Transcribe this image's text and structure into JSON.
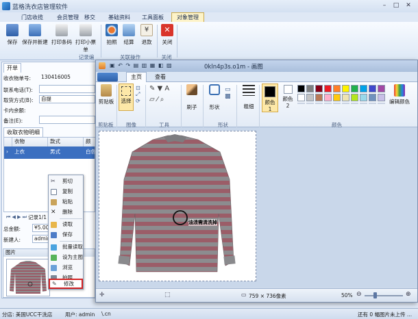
{
  "app": {
    "title": "蓝格洗衣店管理软件",
    "window_controls": [
      "–",
      "□",
      "✕"
    ]
  },
  "menu_tabs": [
    "门店收揽",
    "会员管理",
    "移交",
    "基础资料",
    "工具面板",
    "对象管理"
  ],
  "ribbon": {
    "groups": [
      {
        "label": "记录编",
        "buttons": [
          "保存",
          "保存并新建",
          "打印条码",
          "打印小票 单"
        ]
      },
      {
        "label": "关联操作",
        "buttons": [
          "拍照",
          "结算",
          "退款"
        ]
      },
      {
        "label": "关闭",
        "buttons": [
          "关闭"
        ]
      }
    ]
  },
  "left_panel": {
    "tab": "开单",
    "fields": [
      {
        "label": "收衣物单号:",
        "value": "130416005"
      },
      {
        "label": "联系电话(T):",
        "value": ""
      },
      {
        "label": "取货方式(B):",
        "value": "自提"
      },
      {
        "label": "卡内余额:",
        "value": ""
      },
      {
        "label": "备注(E):",
        "value": ""
      }
    ],
    "detail_tab": "收取衣物明细",
    "grid_headers": [
      "衣物",
      "款式",
      "颜色"
    ],
    "grid_row": [
      "上衣",
      "男式",
      "白色"
    ],
    "pager": "记录1/1",
    "total_label": "总金额:",
    "total_value": "¥5.00",
    "creator_label": "新建人:",
    "creator_value": "admin",
    "image_label": "图片"
  },
  "context_menu": {
    "items": [
      "剪切",
      "复制",
      "粘贴",
      "删除",
      "读取",
      "保存",
      "批量读取",
      "设为主图",
      "浏览",
      "拍照",
      "修改"
    ],
    "highlighted": "修改"
  },
  "paint": {
    "title": "0kln4p3s.o1m - 画图",
    "tabs": [
      "主页",
      "查看"
    ],
    "groups": [
      "剪贴板",
      "图像",
      "工具",
      "形状",
      "颜色"
    ],
    "buttons": {
      "paste": "剪贴板",
      "select": "选择",
      "brush": "刷子",
      "shapes": "形状",
      "thickness": "粗细",
      "color1": "颜色 1",
      "color2": "颜色 2",
      "edit_colors": "编辑颜色"
    },
    "canvas_annotation": "油渍需清洗掉",
    "image_size": "759 × 736像素",
    "zoom": "50%"
  },
  "colors": {
    "accent": "#3a6fb3",
    "highlight_box": "#d32020",
    "palette": [
      "#000000",
      "#7f7f7f",
      "#880015",
      "#ed1c24",
      "#ff7f27",
      "#fff200",
      "#22b14c",
      "#00a2e8",
      "#3f48cc",
      "#a349a4",
      "#ffffff",
      "#c3c3c3",
      "#b97a57",
      "#ffaec9",
      "#ffc90e",
      "#efe4b0",
      "#b5e61d",
      "#99d9ea",
      "#7092be",
      "#c8bfe7"
    ]
  },
  "statusbar": {
    "branch": "分店: 美国UCC干洗店",
    "user": "用户: admin",
    "url": "\\.cn",
    "right": "还有 0 幅图片未上传 ..."
  }
}
